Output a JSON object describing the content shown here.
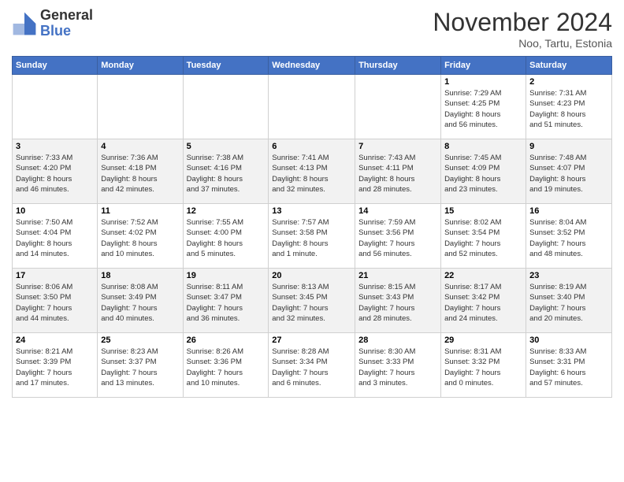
{
  "header": {
    "logo_line1": "General",
    "logo_line2": "Blue",
    "month_title": "November 2024",
    "location": "Noo, Tartu, Estonia"
  },
  "weekdays": [
    "Sunday",
    "Monday",
    "Tuesday",
    "Wednesday",
    "Thursday",
    "Friday",
    "Saturday"
  ],
  "weeks": [
    [
      {
        "day": "",
        "info": ""
      },
      {
        "day": "",
        "info": ""
      },
      {
        "day": "",
        "info": ""
      },
      {
        "day": "",
        "info": ""
      },
      {
        "day": "",
        "info": ""
      },
      {
        "day": "1",
        "info": "Sunrise: 7:29 AM\nSunset: 4:25 PM\nDaylight: 8 hours\nand 56 minutes."
      },
      {
        "day": "2",
        "info": "Sunrise: 7:31 AM\nSunset: 4:23 PM\nDaylight: 8 hours\nand 51 minutes."
      }
    ],
    [
      {
        "day": "3",
        "info": "Sunrise: 7:33 AM\nSunset: 4:20 PM\nDaylight: 8 hours\nand 46 minutes."
      },
      {
        "day": "4",
        "info": "Sunrise: 7:36 AM\nSunset: 4:18 PM\nDaylight: 8 hours\nand 42 minutes."
      },
      {
        "day": "5",
        "info": "Sunrise: 7:38 AM\nSunset: 4:16 PM\nDaylight: 8 hours\nand 37 minutes."
      },
      {
        "day": "6",
        "info": "Sunrise: 7:41 AM\nSunset: 4:13 PM\nDaylight: 8 hours\nand 32 minutes."
      },
      {
        "day": "7",
        "info": "Sunrise: 7:43 AM\nSunset: 4:11 PM\nDaylight: 8 hours\nand 28 minutes."
      },
      {
        "day": "8",
        "info": "Sunrise: 7:45 AM\nSunset: 4:09 PM\nDaylight: 8 hours\nand 23 minutes."
      },
      {
        "day": "9",
        "info": "Sunrise: 7:48 AM\nSunset: 4:07 PM\nDaylight: 8 hours\nand 19 minutes."
      }
    ],
    [
      {
        "day": "10",
        "info": "Sunrise: 7:50 AM\nSunset: 4:04 PM\nDaylight: 8 hours\nand 14 minutes."
      },
      {
        "day": "11",
        "info": "Sunrise: 7:52 AM\nSunset: 4:02 PM\nDaylight: 8 hours\nand 10 minutes."
      },
      {
        "day": "12",
        "info": "Sunrise: 7:55 AM\nSunset: 4:00 PM\nDaylight: 8 hours\nand 5 minutes."
      },
      {
        "day": "13",
        "info": "Sunrise: 7:57 AM\nSunset: 3:58 PM\nDaylight: 8 hours\nand 1 minute."
      },
      {
        "day": "14",
        "info": "Sunrise: 7:59 AM\nSunset: 3:56 PM\nDaylight: 7 hours\nand 56 minutes."
      },
      {
        "day": "15",
        "info": "Sunrise: 8:02 AM\nSunset: 3:54 PM\nDaylight: 7 hours\nand 52 minutes."
      },
      {
        "day": "16",
        "info": "Sunrise: 8:04 AM\nSunset: 3:52 PM\nDaylight: 7 hours\nand 48 minutes."
      }
    ],
    [
      {
        "day": "17",
        "info": "Sunrise: 8:06 AM\nSunset: 3:50 PM\nDaylight: 7 hours\nand 44 minutes."
      },
      {
        "day": "18",
        "info": "Sunrise: 8:08 AM\nSunset: 3:49 PM\nDaylight: 7 hours\nand 40 minutes."
      },
      {
        "day": "19",
        "info": "Sunrise: 8:11 AM\nSunset: 3:47 PM\nDaylight: 7 hours\nand 36 minutes."
      },
      {
        "day": "20",
        "info": "Sunrise: 8:13 AM\nSunset: 3:45 PM\nDaylight: 7 hours\nand 32 minutes."
      },
      {
        "day": "21",
        "info": "Sunrise: 8:15 AM\nSunset: 3:43 PM\nDaylight: 7 hours\nand 28 minutes."
      },
      {
        "day": "22",
        "info": "Sunrise: 8:17 AM\nSunset: 3:42 PM\nDaylight: 7 hours\nand 24 minutes."
      },
      {
        "day": "23",
        "info": "Sunrise: 8:19 AM\nSunset: 3:40 PM\nDaylight: 7 hours\nand 20 minutes."
      }
    ],
    [
      {
        "day": "24",
        "info": "Sunrise: 8:21 AM\nSunset: 3:39 PM\nDaylight: 7 hours\nand 17 minutes."
      },
      {
        "day": "25",
        "info": "Sunrise: 8:23 AM\nSunset: 3:37 PM\nDaylight: 7 hours\nand 13 minutes."
      },
      {
        "day": "26",
        "info": "Sunrise: 8:26 AM\nSunset: 3:36 PM\nDaylight: 7 hours\nand 10 minutes."
      },
      {
        "day": "27",
        "info": "Sunrise: 8:28 AM\nSunset: 3:34 PM\nDaylight: 7 hours\nand 6 minutes."
      },
      {
        "day": "28",
        "info": "Sunrise: 8:30 AM\nSunset: 3:33 PM\nDaylight: 7 hours\nand 3 minutes."
      },
      {
        "day": "29",
        "info": "Sunrise: 8:31 AM\nSunset: 3:32 PM\nDaylight: 7 hours\nand 0 minutes."
      },
      {
        "day": "30",
        "info": "Sunrise: 8:33 AM\nSunset: 3:31 PM\nDaylight: 6 hours\nand 57 minutes."
      }
    ]
  ]
}
